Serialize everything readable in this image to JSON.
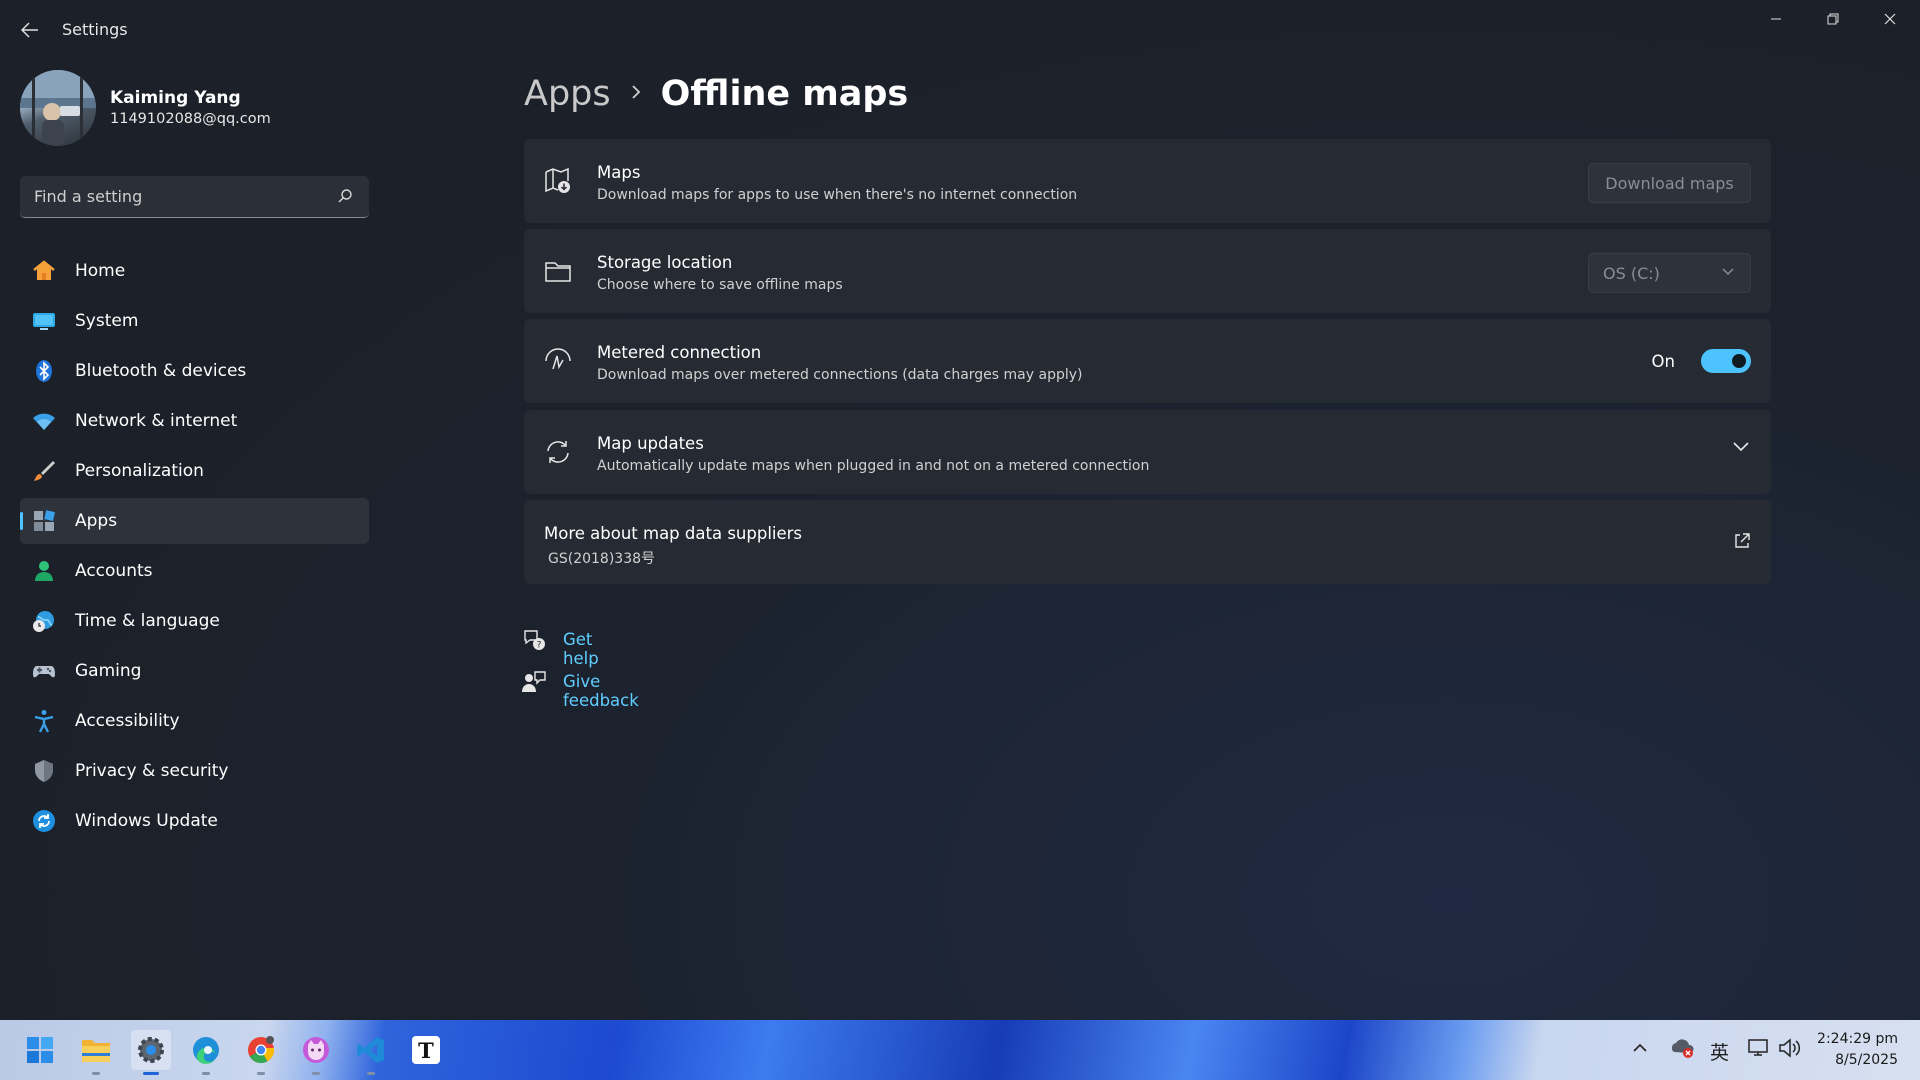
{
  "window": {
    "title": "Settings"
  },
  "profile": {
    "name": "Kaiming Yang",
    "email": "1149102088@qq.com"
  },
  "search": {
    "placeholder": "Find a setting"
  },
  "nav": {
    "items": [
      {
        "label": "Home",
        "icon": "home-icon"
      },
      {
        "label": "System",
        "icon": "system-icon"
      },
      {
        "label": "Bluetooth & devices",
        "icon": "bluetooth-icon"
      },
      {
        "label": "Network & internet",
        "icon": "wifi-icon"
      },
      {
        "label": "Personalization",
        "icon": "brush-icon"
      },
      {
        "label": "Apps",
        "icon": "apps-icon",
        "active": true
      },
      {
        "label": "Accounts",
        "icon": "person-icon"
      },
      {
        "label": "Time & language",
        "icon": "globe-clock-icon"
      },
      {
        "label": "Gaming",
        "icon": "gamepad-icon"
      },
      {
        "label": "Accessibility",
        "icon": "accessibility-icon"
      },
      {
        "label": "Privacy & security",
        "icon": "shield-icon"
      },
      {
        "label": "Windows Update",
        "icon": "update-icon"
      }
    ]
  },
  "breadcrumb": {
    "parent": "Apps",
    "current": "Offline maps"
  },
  "cards": {
    "maps": {
      "title": "Maps",
      "desc": "Download maps for apps to use when there's no internet connection",
      "button": "Download maps"
    },
    "storage": {
      "title": "Storage location",
      "desc": "Choose where to save offline maps",
      "value": "OS (C:)"
    },
    "metered": {
      "title": "Metered connection",
      "desc": "Download maps over metered connections (data charges may apply)",
      "state": "On",
      "enabled": true
    },
    "updates": {
      "title": "Map updates",
      "desc": "Automatically update maps when plugged in and not on a metered connection"
    },
    "suppliers": {
      "title": "More about map data suppliers",
      "desc": "GS(2018)338号"
    }
  },
  "links": {
    "help": "Get help",
    "feedback": "Give feedback"
  },
  "taskbar": {
    "apps": [
      "start-icon",
      "file-explorer-icon",
      "settings-icon",
      "edge-icon",
      "chrome-icon",
      "cat-app-icon",
      "vscode-icon",
      "typora-icon"
    ],
    "ime": "英",
    "time": "2:24:29 pm",
    "date": "8/5/2025"
  },
  "colors": {
    "accent": "#4cc2ff",
    "link": "#60cdff",
    "card": "#262b33",
    "background": "#1c2028"
  }
}
